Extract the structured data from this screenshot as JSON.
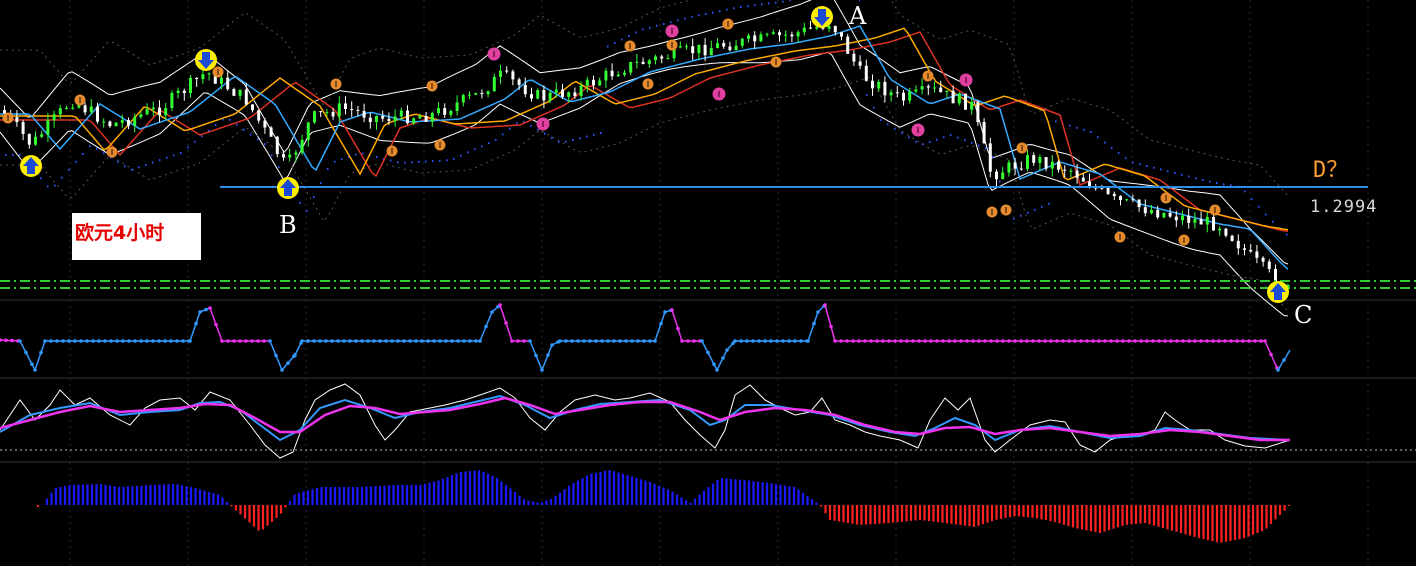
{
  "chart_data": {
    "type": "candlestick",
    "annotation_text": "欧元4小时",
    "price_label": "1.2994",
    "question_label": "D？",
    "point_labels": [
      "A",
      "B",
      "C"
    ],
    "colors": {
      "background": "#000000",
      "candle_up": "#33ff33",
      "candle_down": "#ffffff",
      "band": "#ffffff",
      "ma_fast": "#33aaff",
      "ma_slow_red": "#dd3322",
      "ma_slow_orange": "#ffaa00",
      "support_line": "#2e8be6",
      "dashed_level": "#33cc33",
      "osc1_up": "#3399ff",
      "osc1_down": "#ee33ee",
      "osc2_white": "#ffffff",
      "osc2_blue": "#3399ff",
      "osc2_magenta": "#ee33ee",
      "hist_pos": "#1a1aff",
      "hist_neg": "#ff2020",
      "signal_orange": "#e68a2e",
      "signal_pink": "#e040a0",
      "arrow_yellow": "#ffee00",
      "arrow_blue": "#1a4ad6"
    },
    "price_path": [
      [
        0,
        110
      ],
      [
        30,
        145
      ],
      [
        70,
        100
      ],
      [
        110,
        125
      ],
      [
        160,
        108
      ],
      [
        205,
        72
      ],
      [
        245,
        100
      ],
      [
        285,
        168
      ],
      [
        310,
        118
      ],
      [
        340,
        108
      ],
      [
        380,
        118
      ],
      [
        430,
        115
      ],
      [
        475,
        95
      ],
      [
        500,
        75
      ],
      [
        540,
        98
      ],
      [
        580,
        88
      ],
      [
        620,
        68
      ],
      [
        670,
        55
      ],
      [
        720,
        45
      ],
      [
        760,
        40
      ],
      [
        800,
        32
      ],
      [
        830,
        22
      ],
      [
        860,
        75
      ],
      [
        900,
        100
      ],
      [
        930,
        90
      ],
      [
        970,
        105
      ],
      [
        990,
        175
      ],
      [
        1030,
        158
      ],
      [
        1070,
        170
      ],
      [
        1110,
        200
      ],
      [
        1150,
        210
      ],
      [
        1190,
        220
      ],
      [
        1220,
        225
      ],
      [
        1250,
        258
      ],
      [
        1285,
        290
      ]
    ],
    "support_level": 1.2994,
    "osc1_values": [
      [
        0,
        340
      ],
      [
        20,
        341
      ],
      [
        35,
        370
      ],
      [
        45,
        341
      ],
      [
        190,
        341
      ],
      [
        200,
        312
      ],
      [
        210,
        308
      ],
      [
        222,
        341
      ],
      [
        270,
        341
      ],
      [
        282,
        370
      ],
      [
        295,
        355
      ],
      [
        302,
        341
      ],
      [
        480,
        341
      ],
      [
        492,
        312
      ],
      [
        500,
        305
      ],
      [
        512,
        341
      ],
      [
        530,
        341
      ],
      [
        542,
        370
      ],
      [
        552,
        345
      ],
      [
        560,
        341
      ],
      [
        655,
        341
      ],
      [
        665,
        312
      ],
      [
        672,
        310
      ],
      [
        682,
        341
      ],
      [
        702,
        341
      ],
      [
        717,
        370
      ],
      [
        727,
        350
      ],
      [
        735,
        341
      ],
      [
        808,
        341
      ],
      [
        818,
        312
      ],
      [
        825,
        305
      ],
      [
        835,
        341
      ],
      [
        1265,
        341
      ],
      [
        1278,
        370
      ],
      [
        1290,
        350
      ]
    ],
    "osc2_white": [
      [
        0,
        430
      ],
      [
        20,
        400
      ],
      [
        35,
        420
      ],
      [
        50,
        405
      ],
      [
        60,
        390
      ],
      [
        75,
        405
      ],
      [
        90,
        398
      ],
      [
        110,
        415
      ],
      [
        130,
        425
      ],
      [
        145,
        408
      ],
      [
        160,
        400
      ],
      [
        180,
        398
      ],
      [
        195,
        410
      ],
      [
        210,
        392
      ],
      [
        230,
        400
      ],
      [
        250,
        425
      ],
      [
        265,
        445
      ],
      [
        280,
        458
      ],
      [
        293,
        452
      ],
      [
        305,
        420
      ],
      [
        315,
        400
      ],
      [
        330,
        390
      ],
      [
        345,
        384
      ],
      [
        360,
        395
      ],
      [
        375,
        425
      ],
      [
        385,
        440
      ],
      [
        395,
        430
      ],
      [
        410,
        412
      ],
      [
        430,
        408
      ],
      [
        445,
        405
      ],
      [
        465,
        400
      ],
      [
        480,
        395
      ],
      [
        500,
        388
      ],
      [
        515,
        398
      ],
      [
        530,
        418
      ],
      [
        545,
        430
      ],
      [
        560,
        412
      ],
      [
        575,
        400
      ],
      [
        595,
        395
      ],
      [
        615,
        400
      ],
      [
        630,
        398
      ],
      [
        650,
        393
      ],
      [
        670,
        402
      ],
      [
        685,
        420
      ],
      [
        700,
        435
      ],
      [
        715,
        448
      ],
      [
        725,
        430
      ],
      [
        735,
        395
      ],
      [
        750,
        385
      ],
      [
        765,
        400
      ],
      [
        780,
        408
      ],
      [
        795,
        415
      ],
      [
        810,
        412
      ],
      [
        822,
        398
      ],
      [
        835,
        420
      ],
      [
        850,
        425
      ],
      [
        865,
        432
      ],
      [
        880,
        436
      ],
      [
        900,
        440
      ],
      [
        918,
        448
      ],
      [
        930,
        420
      ],
      [
        945,
        398
      ],
      [
        958,
        410
      ],
      [
        970,
        398
      ],
      [
        985,
        440
      ],
      [
        995,
        452
      ],
      [
        1010,
        440
      ],
      [
        1030,
        425
      ],
      [
        1050,
        420
      ],
      [
        1065,
        422
      ],
      [
        1080,
        445
      ],
      [
        1095,
        452
      ],
      [
        1110,
        440
      ],
      [
        1125,
        435
      ],
      [
        1140,
        435
      ],
      [
        1155,
        430
      ],
      [
        1165,
        412
      ],
      [
        1175,
        420
      ],
      [
        1190,
        430
      ],
      [
        1210,
        430
      ],
      [
        1225,
        440
      ],
      [
        1245,
        446
      ],
      [
        1265,
        448
      ],
      [
        1290,
        440
      ]
    ],
    "osc2_blue": [
      [
        0,
        432
      ],
      [
        30,
        415
      ],
      [
        60,
        408
      ],
      [
        90,
        403
      ],
      [
        120,
        415
      ],
      [
        150,
        412
      ],
      [
        180,
        410
      ],
      [
        200,
        403
      ],
      [
        220,
        402
      ],
      [
        240,
        410
      ],
      [
        260,
        425
      ],
      [
        280,
        440
      ],
      [
        300,
        430
      ],
      [
        320,
        408
      ],
      [
        345,
        400
      ],
      [
        370,
        408
      ],
      [
        395,
        418
      ],
      [
        420,
        412
      ],
      [
        450,
        408
      ],
      [
        475,
        402
      ],
      [
        500,
        396
      ],
      [
        525,
        405
      ],
      [
        550,
        418
      ],
      [
        575,
        410
      ],
      [
        600,
        404
      ],
      [
        630,
        402
      ],
      [
        660,
        400
      ],
      [
        690,
        410
      ],
      [
        710,
        425
      ],
      [
        725,
        420
      ],
      [
        745,
        405
      ],
      [
        770,
        405
      ],
      [
        800,
        410
      ],
      [
        830,
        415
      ],
      [
        860,
        425
      ],
      [
        890,
        432
      ],
      [
        915,
        436
      ],
      [
        935,
        428
      ],
      [
        955,
        418
      ],
      [
        975,
        425
      ],
      [
        995,
        440
      ],
      [
        1020,
        430
      ],
      [
        1050,
        426
      ],
      [
        1080,
        432
      ],
      [
        1110,
        438
      ],
      [
        1140,
        436
      ],
      [
        1165,
        428
      ],
      [
        1190,
        430
      ],
      [
        1220,
        434
      ],
      [
        1250,
        438
      ],
      [
        1290,
        440
      ]
    ],
    "osc2_magenta": [
      [
        0,
        428
      ],
      [
        30,
        420
      ],
      [
        60,
        412
      ],
      [
        90,
        406
      ],
      [
        120,
        412
      ],
      [
        150,
        410
      ],
      [
        180,
        408
      ],
      [
        205,
        404
      ],
      [
        230,
        405
      ],
      [
        255,
        418
      ],
      [
        280,
        432
      ],
      [
        300,
        432
      ],
      [
        325,
        415
      ],
      [
        350,
        406
      ],
      [
        375,
        408
      ],
      [
        400,
        414
      ],
      [
        425,
        412
      ],
      [
        450,
        410
      ],
      [
        480,
        404
      ],
      [
        505,
        398
      ],
      [
        530,
        405
      ],
      [
        555,
        414
      ],
      [
        580,
        410
      ],
      [
        610,
        405
      ],
      [
        640,
        402
      ],
      [
        670,
        402
      ],
      [
        700,
        412
      ],
      [
        720,
        420
      ],
      [
        745,
        412
      ],
      [
        775,
        408
      ],
      [
        805,
        410
      ],
      [
        835,
        415
      ],
      [
        865,
        425
      ],
      [
        895,
        432
      ],
      [
        920,
        434
      ],
      [
        945,
        428
      ],
      [
        970,
        427
      ],
      [
        995,
        434
      ],
      [
        1020,
        430
      ],
      [
        1050,
        428
      ],
      [
        1080,
        432
      ],
      [
        1110,
        436
      ],
      [
        1140,
        434
      ],
      [
        1170,
        430
      ],
      [
        1200,
        432
      ],
      [
        1230,
        436
      ],
      [
        1260,
        440
      ],
      [
        1290,
        440
      ]
    ],
    "histogram": [
      [
        0,
        505
      ],
      [
        35,
        505
      ],
      [
        40,
        508
      ],
      [
        55,
        488
      ],
      [
        70,
        485
      ],
      [
        100,
        484
      ],
      [
        120,
        487
      ],
      [
        150,
        485
      ],
      [
        175,
        484
      ],
      [
        195,
        488
      ],
      [
        220,
        495
      ],
      [
        230,
        505
      ],
      [
        260,
        532
      ],
      [
        280,
        515
      ],
      [
        295,
        494
      ],
      [
        320,
        487
      ],
      [
        360,
        487
      ],
      [
        395,
        485
      ],
      [
        420,
        485
      ],
      [
        440,
        480
      ],
      [
        460,
        472
      ],
      [
        480,
        470
      ],
      [
        497,
        478
      ],
      [
        510,
        488
      ],
      [
        525,
        500
      ],
      [
        540,
        503
      ],
      [
        553,
        498
      ],
      [
        570,
        485
      ],
      [
        590,
        474
      ],
      [
        610,
        470
      ],
      [
        630,
        476
      ],
      [
        650,
        482
      ],
      [
        670,
        490
      ],
      [
        690,
        503
      ],
      [
        705,
        490
      ],
      [
        720,
        478
      ],
      [
        745,
        480
      ],
      [
        770,
        483
      ],
      [
        795,
        487
      ],
      [
        820,
        505
      ],
      [
        830,
        520
      ],
      [
        860,
        525
      ],
      [
        890,
        523
      ],
      [
        920,
        520
      ],
      [
        945,
        523
      ],
      [
        975,
        527
      ],
      [
        995,
        520
      ],
      [
        1015,
        516
      ],
      [
        1035,
        518
      ],
      [
        1055,
        522
      ],
      [
        1075,
        528
      ],
      [
        1100,
        533
      ],
      [
        1125,
        525
      ],
      [
        1145,
        523
      ],
      [
        1170,
        530
      ],
      [
        1195,
        537
      ],
      [
        1220,
        543
      ],
      [
        1245,
        538
      ],
      [
        1265,
        530
      ],
      [
        1290,
        505
      ]
    ]
  }
}
